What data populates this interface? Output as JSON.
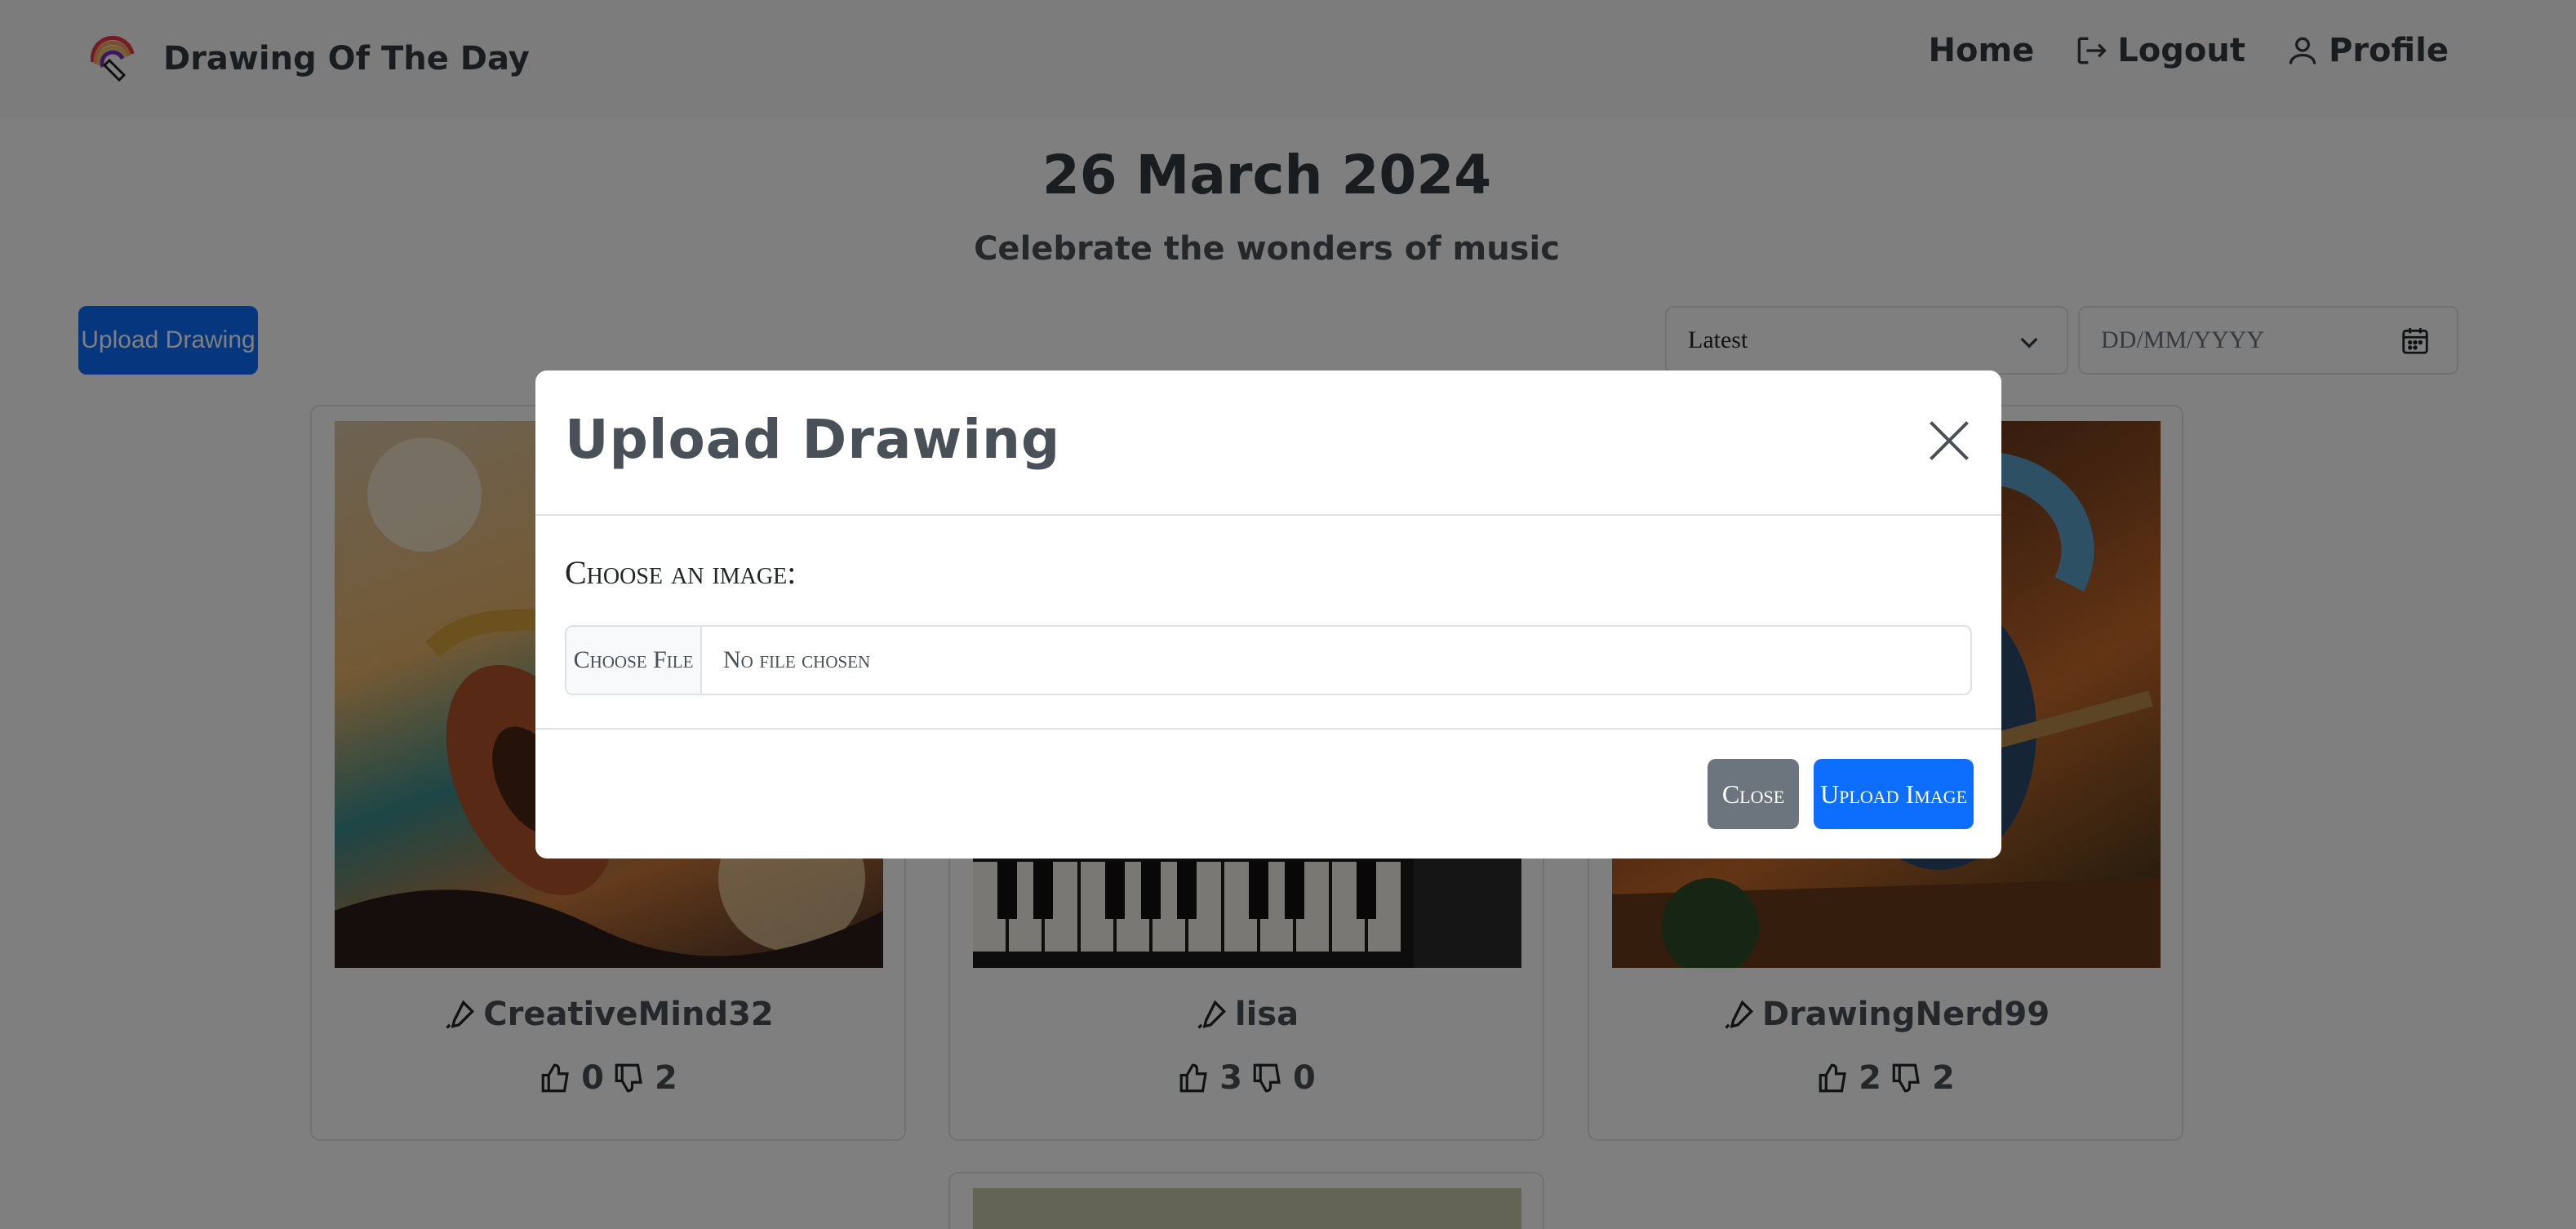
{
  "navbar": {
    "brand": "Drawing Of The Day",
    "links": {
      "home": "Home",
      "logout": "Logout",
      "profile": "Profile"
    }
  },
  "header": {
    "date": "26 March 2024",
    "theme": "Celebrate the wonders of music"
  },
  "toolbar": {
    "upload_label": "Upload Drawing",
    "sort_selected": "Latest",
    "date_placeholder": "DD/MM/YYYY"
  },
  "cards": [
    {
      "author": "CreativeMind32",
      "likes": "0",
      "dislikes": "2"
    },
    {
      "author": "lisa",
      "likes": "3",
      "dislikes": "0"
    },
    {
      "author": "DrawingNerd99",
      "likes": "2",
      "dislikes": "2"
    }
  ],
  "modal": {
    "title": "Upload Drawing",
    "choose_label": "Choose an image:",
    "file_button": "Choose File",
    "file_status": "No file chosen",
    "close_label": "Close",
    "upload_label": "Upload Image"
  },
  "colors": {
    "primary": "#0d6efd",
    "secondary": "#6c757d",
    "navbar_bg": "#f8f9fa"
  }
}
